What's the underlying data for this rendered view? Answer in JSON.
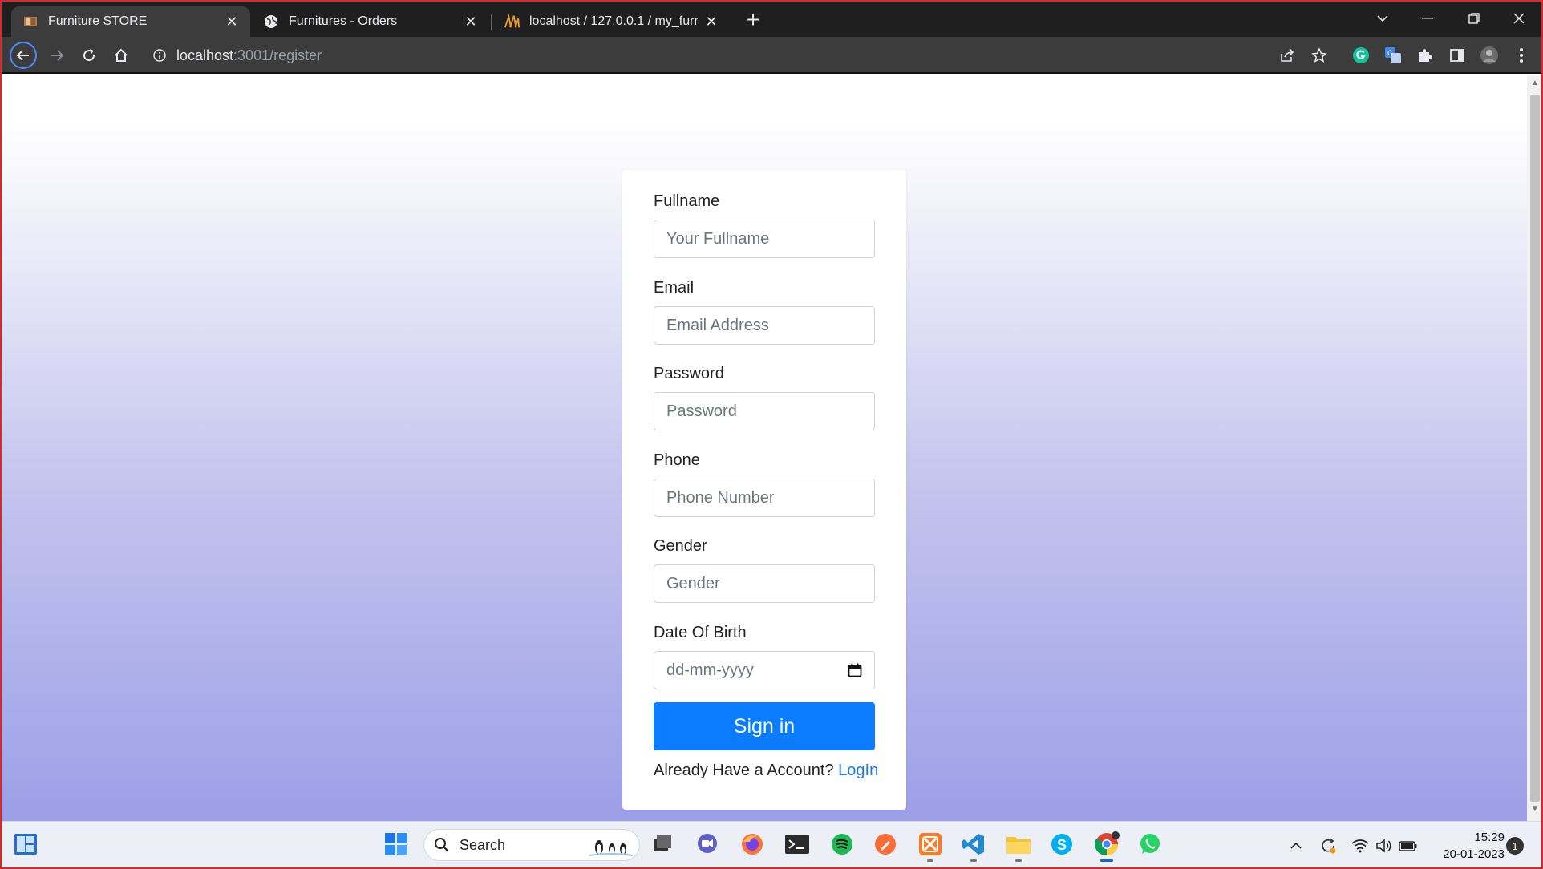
{
  "browser": {
    "tabs": [
      {
        "title": "Furniture STORE",
        "favicon": "furniture-favicon",
        "active": true
      },
      {
        "title": "Furnitures - Orders",
        "favicon": "globe-icon",
        "active": false
      },
      {
        "title": "localhost / 127.0.0.1 / my_furnitu",
        "favicon": "phpmyadmin-icon",
        "active": false
      }
    ],
    "url": {
      "host": "localhost",
      "path": ":3001/register"
    }
  },
  "form": {
    "fields": [
      {
        "label": "Fullname",
        "placeholder": "Your Fullname",
        "type": "text"
      },
      {
        "label": "Email",
        "placeholder": "Email Address",
        "type": "email"
      },
      {
        "label": "Password",
        "placeholder": "Password",
        "type": "password"
      },
      {
        "label": "Phone",
        "placeholder": "Phone Number",
        "type": "text"
      },
      {
        "label": "Gender",
        "placeholder": "Gender",
        "type": "text"
      },
      {
        "label": "Date Of Birth",
        "placeholder": "dd-mm-yyyy",
        "type": "date"
      }
    ],
    "submit_label": "Sign in",
    "account_prompt": "Already Have a Account?",
    "login_link": "LogIn",
    "colors": {
      "button": "#0b7bff",
      "link": "#1a7ae8"
    }
  },
  "taskbar": {
    "search_label": "Search",
    "time": "15:29",
    "date": "20-01-2023",
    "notifications": "1"
  }
}
